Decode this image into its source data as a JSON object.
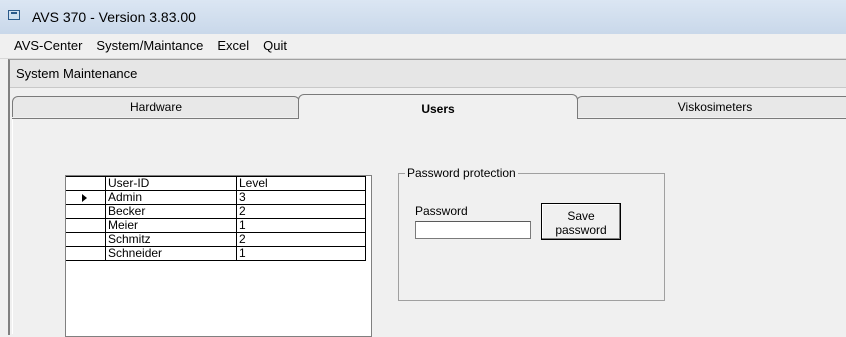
{
  "window": {
    "title": "AVS 370 - Version 3.83.00"
  },
  "menu": {
    "items": [
      {
        "label": "AVS-Center",
        "name": "menu-avs-center"
      },
      {
        "label": "System/Maintance",
        "name": "menu-system-maintance"
      },
      {
        "label": "Excel",
        "name": "menu-excel"
      },
      {
        "label": "Quit",
        "name": "menu-quit"
      }
    ]
  },
  "child_window": {
    "title": "System Maintenance"
  },
  "tabs": [
    {
      "label": "Hardware",
      "active": false
    },
    {
      "label": "Users",
      "active": true
    },
    {
      "label": "Viskosimeters",
      "active": false
    }
  ],
  "users_grid": {
    "columns": [
      "User-ID",
      "Level"
    ],
    "rows": [
      {
        "user": "Admin",
        "level": "3",
        "current": true
      },
      {
        "user": "Becker",
        "level": "2",
        "current": false
      },
      {
        "user": "Meier",
        "level": "1",
        "current": false
      },
      {
        "user": "Schmitz",
        "level": "2",
        "current": false
      },
      {
        "user": "Schneider",
        "level": "1",
        "current": false
      }
    ]
  },
  "password_group": {
    "legend": "Password protection",
    "label": "Password",
    "value": "",
    "save_label": "Save\npassword"
  },
  "icons": {
    "app": "app-window-icon",
    "row_pointer": "row-pointer-icon"
  }
}
